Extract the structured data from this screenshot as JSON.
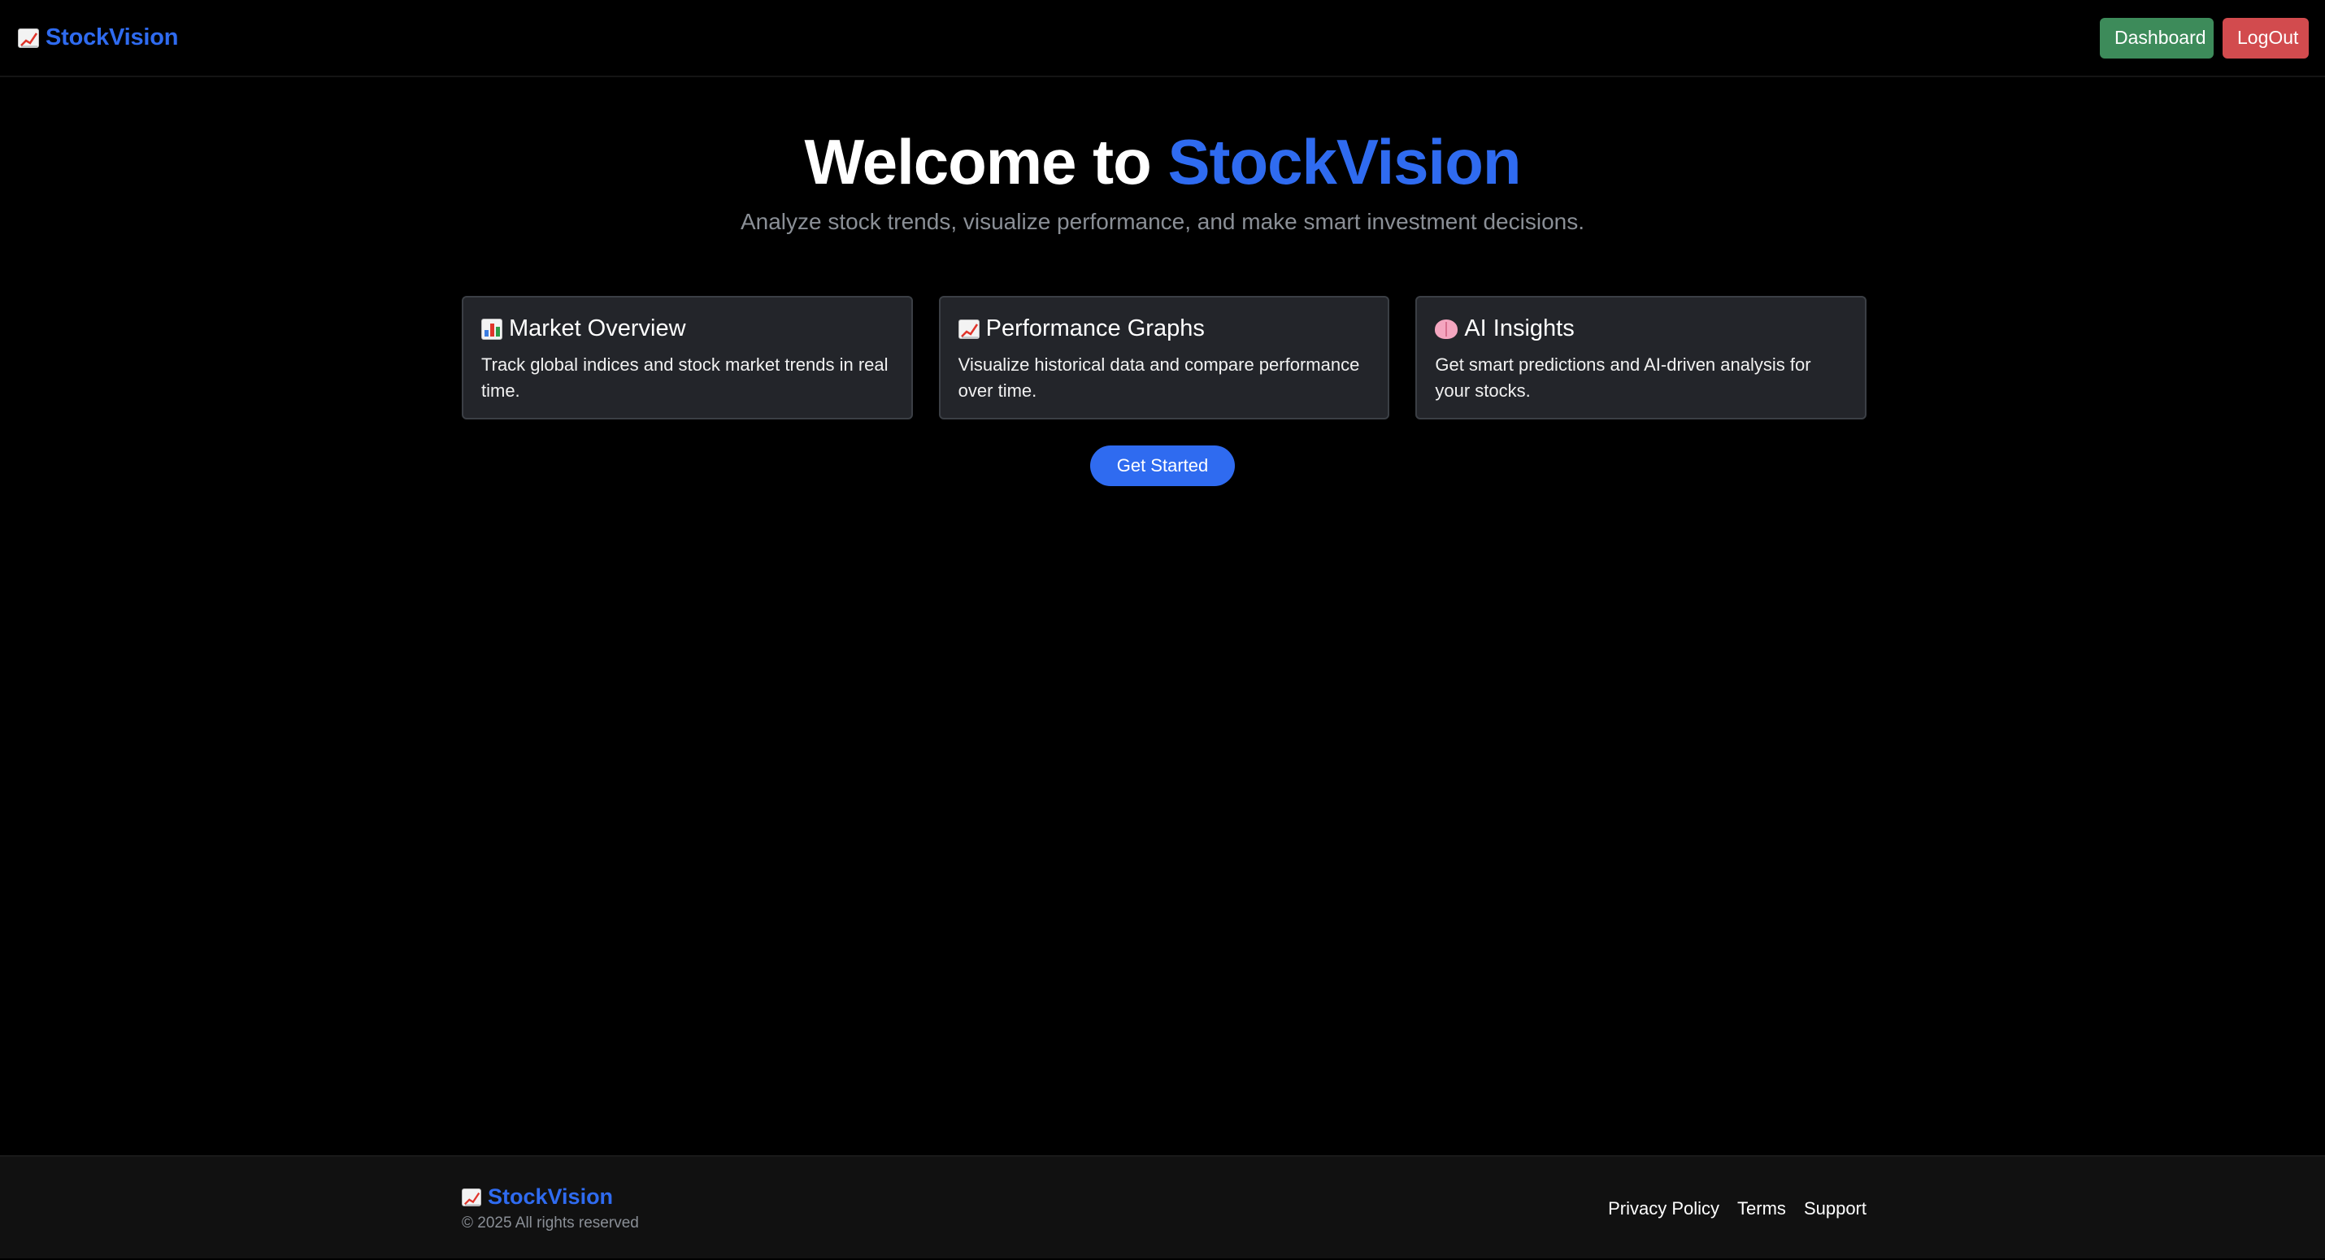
{
  "navbar": {
    "brand_icon": "chart-increasing-icon",
    "brand": "StockVision",
    "dashboard_label": "Dashboard",
    "logout_label": "LogOut",
    "dashboard_color": "#3d8b5a",
    "logout_color": "#d24b4e"
  },
  "hero": {
    "title_prefix": "Welcome to",
    "title_accent": "StockVision",
    "subtitle": "Analyze stock trends, visualize performance, and make smart investment decisions.",
    "accent_color": "#2f6bf0"
  },
  "cards": [
    {
      "icon": "bar-chart-icon",
      "title": "Market Overview",
      "description": "Track global indices and stock market trends in real time."
    },
    {
      "icon": "chart-increasing-icon",
      "title": "Performance Graphs",
      "description": "Visualize historical data and compare performance over time."
    },
    {
      "icon": "brain-icon",
      "title": "AI Insights",
      "description": "Get smart predictions and AI-driven analysis for your stocks."
    }
  ],
  "cta": {
    "label": "Get Started"
  },
  "footer": {
    "brand_icon": "chart-increasing-icon",
    "brand": "StockVision",
    "copyright": "© 2025 All rights reserved",
    "links": [
      "Privacy Policy",
      "Terms",
      "Support"
    ]
  }
}
